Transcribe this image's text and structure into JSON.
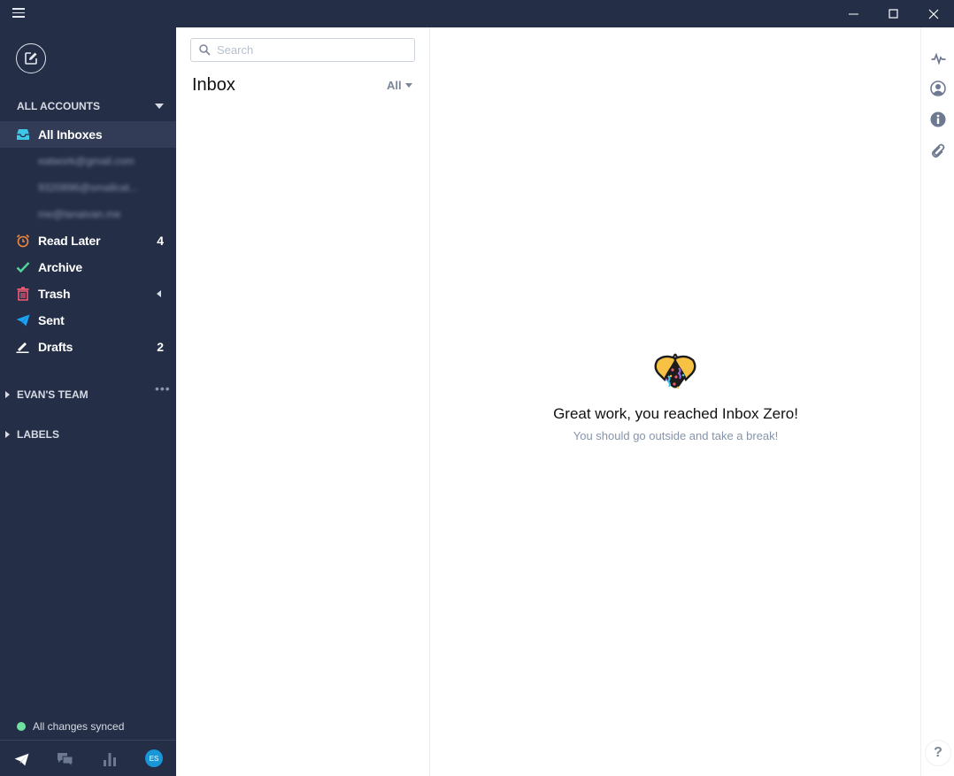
{
  "window": {
    "controls": [
      "minimize",
      "maximize",
      "close"
    ]
  },
  "sidebar": {
    "compose_icon": "compose-icon",
    "accounts_header": "ALL ACCOUNTS",
    "all_inboxes": "All Inboxes",
    "accounts": [
      "eatwork@gmail.com",
      "9320896@smallcat...",
      "me@lanaivan.me"
    ],
    "folders": [
      {
        "label": "Read Later",
        "icon": "alarm-clock-icon",
        "count": "4",
        "color": "#f0883e"
      },
      {
        "label": "Archive",
        "icon": "checkmark-icon",
        "count": "",
        "color": "#55d49a"
      },
      {
        "label": "Trash",
        "icon": "trash-icon",
        "count": "",
        "color": "#f25a74"
      },
      {
        "label": "Sent",
        "icon": "paper-plane-icon",
        "count": "",
        "color": "#1da1f2"
      },
      {
        "label": "Drafts",
        "icon": "pencil-icon",
        "count": "2",
        "color": "#ffffff"
      }
    ],
    "team_header": "EVAN'S TEAM",
    "team_more": "•••",
    "labels_header": "LABELS",
    "sync_status": "All changes synced",
    "avatar_initials": "ES"
  },
  "list_pane": {
    "search_placeholder": "Search",
    "title": "Inbox",
    "filter_label": "All"
  },
  "content": {
    "empty_title": "Great work, you reached Inbox Zero!",
    "empty_subtitle": "You should go outside and take a break!"
  },
  "right_rail": {
    "icons": [
      "activity-icon",
      "contact-icon",
      "info-icon",
      "attachment-icon"
    ],
    "help_label": "?"
  },
  "colors": {
    "sidebar_bg": "#242e47",
    "active_bg": "#323c56",
    "accent_blue": "#1996d8",
    "sync_green": "#6ee0a0"
  }
}
